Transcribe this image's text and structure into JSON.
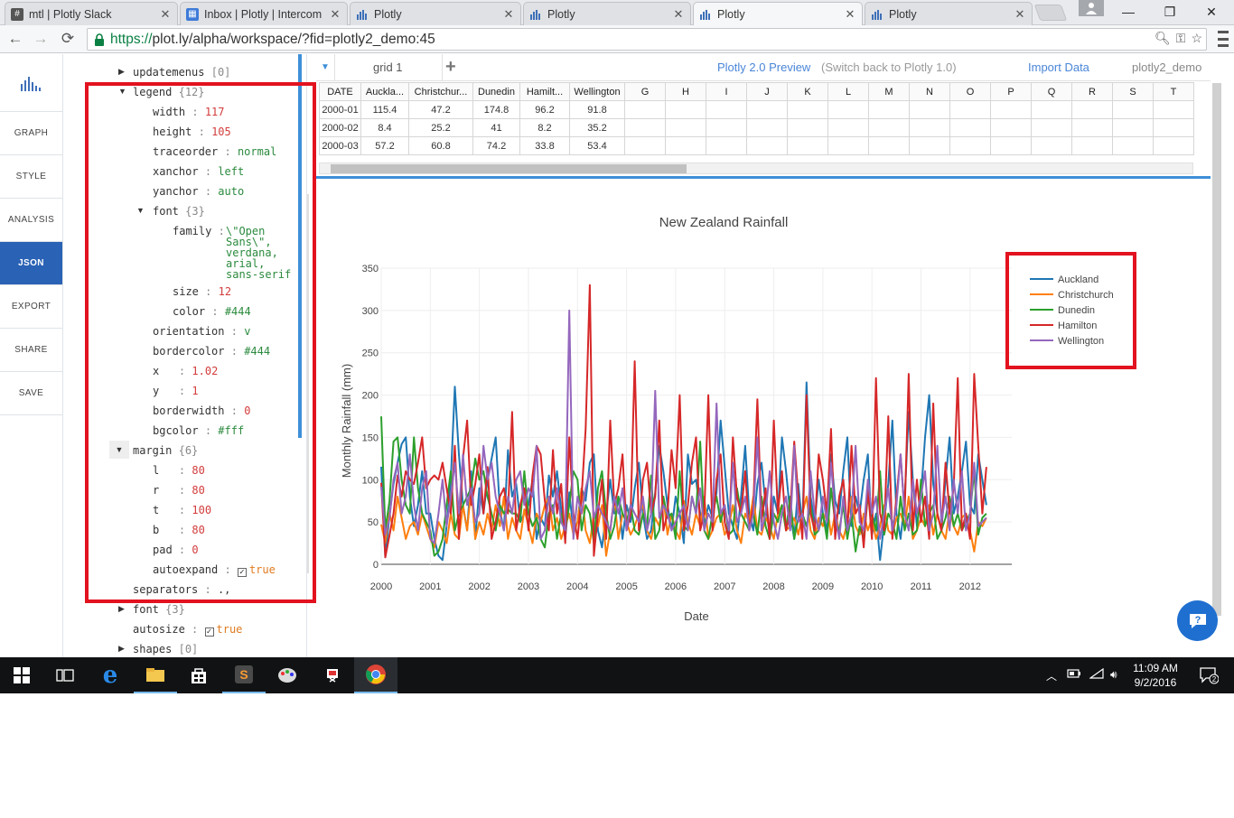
{
  "browser": {
    "tabs": [
      {
        "label": "mtl | Plotly Slack",
        "icon": "slack-hash-icon"
      },
      {
        "label": "Inbox | Plotly | Intercom",
        "icon": "intercom-icon"
      },
      {
        "label": "Plotly",
        "icon": "plotly-icon"
      },
      {
        "label": "Plotly",
        "icon": "plotly-icon"
      },
      {
        "label": "Plotly",
        "icon": "plotly-icon",
        "active": true
      },
      {
        "label": "Plotly",
        "icon": "plotly-icon"
      }
    ],
    "url_scheme": "https://",
    "url_rest": "plot.ly/alpha/workspace/?fid=plotly2_demo:45"
  },
  "sidebar": {
    "items": [
      {
        "label": "GRAPH"
      },
      {
        "label": "STYLE"
      },
      {
        "label": "ANALYSIS"
      },
      {
        "label": "JSON",
        "active": true
      },
      {
        "label": "EXPORT"
      },
      {
        "label": "SHARE"
      },
      {
        "label": "SAVE"
      }
    ]
  },
  "json_tree": {
    "updatemenus": {
      "key": "updatemenus",
      "count": "[0]"
    },
    "legend": {
      "key": "legend",
      "count": "{12}"
    },
    "width": {
      "key": "width",
      "value": "117"
    },
    "height": {
      "key": "height",
      "value": "105"
    },
    "traceorder": {
      "key": "traceorder",
      "value": "normal"
    },
    "xanchor": {
      "key": "xanchor",
      "value": "left"
    },
    "yanchor": {
      "key": "yanchor",
      "value": "auto"
    },
    "font": {
      "key": "font",
      "count": "{3}"
    },
    "family": {
      "key": "family",
      "value_lines": [
        "\\\"Open",
        "Sans\\\",",
        "verdana,",
        "arial,",
        "sans-serif"
      ]
    },
    "size": {
      "key": "size",
      "value": "12"
    },
    "color": {
      "key": "color",
      "value": "#444"
    },
    "orientation": {
      "key": "orientation",
      "value": "v"
    },
    "bordercolor": {
      "key": "bordercolor",
      "value": "#444"
    },
    "x": {
      "key": "x",
      "value": "1.02"
    },
    "y": {
      "key": "y",
      "value": "1"
    },
    "borderwidth": {
      "key": "borderwidth",
      "value": "0"
    },
    "bgcolor": {
      "key": "bgcolor",
      "value": "#fff"
    },
    "margin": {
      "key": "margin",
      "count": "{6}"
    },
    "l": {
      "key": "l",
      "value": "80"
    },
    "r": {
      "key": "r",
      "value": "80"
    },
    "t": {
      "key": "t",
      "value": "100"
    },
    "b": {
      "key": "b",
      "value": "80"
    },
    "pad": {
      "key": "pad",
      "value": "0"
    },
    "autoexpand": {
      "key": "autoexpand",
      "value": "true"
    },
    "separators": {
      "key": "separators",
      "value": ".,"
    },
    "font2": {
      "key": "font",
      "count": "{3}"
    },
    "autosize": {
      "key": "autosize",
      "value": "true"
    },
    "shapes": {
      "key": "shapes",
      "count": "[0]"
    }
  },
  "grid": {
    "tab_label": "grid 1",
    "preview_label": "Plotly 2.0 Preview",
    "switch_back": "(Switch back to Plotly 1.0)",
    "import_data": "Import Data",
    "file_name": "plotly2_demo",
    "columns": [
      "DATE",
      "Auckla...",
      "Christchur...",
      "Dunedin",
      "Hamilt...",
      "Wellington",
      "G",
      "H",
      "I",
      "J",
      "K",
      "L",
      "M",
      "N",
      "O",
      "P",
      "Q",
      "R",
      "S",
      "T"
    ],
    "rows": [
      [
        "2000-01",
        "115.4",
        "47.2",
        "174.8",
        "96.2",
        "91.8"
      ],
      [
        "2000-02",
        "8.4",
        "25.2",
        "41",
        "8.2",
        "35.2"
      ],
      [
        "2000-03",
        "57.2",
        "60.8",
        "74.2",
        "33.8",
        "53.4"
      ]
    ]
  },
  "colors": {
    "accent": "#2a62b5",
    "highlight": "#e3121f"
  },
  "chart_data": {
    "type": "line",
    "title": "New Zealand Rainfall",
    "xlabel": "Date",
    "ylabel": "Monthly Rainfall (mm)",
    "xlim": [
      2000,
      2012.85
    ],
    "ylim": [
      0,
      350
    ],
    "xticks": [
      "2000",
      "2001",
      "2002",
      "2003",
      "2004",
      "2005",
      "2006",
      "2007",
      "2008",
      "2009",
      "2010",
      "2011",
      "2012"
    ],
    "yticks": [
      "0",
      "50",
      "100",
      "150",
      "200",
      "250",
      "300",
      "350"
    ],
    "grid": true,
    "legend_position": "top-right",
    "x_start": "2000-01",
    "series": [
      {
        "name": "Auckland",
        "color": "#1f77b4",
        "values": [
          115.4,
          8.4,
          57.2,
          95,
          120,
          142,
          150,
          80,
          45,
          70,
          110,
          60,
          60,
          30,
          10,
          5,
          45,
          100,
          210,
          130,
          70,
          40,
          110,
          30,
          90,
          60,
          100,
          125,
          150,
          65,
          40,
          135,
          80,
          95,
          50,
          60,
          70,
          100,
          30,
          55,
          45,
          105,
          80,
          110,
          65,
          30,
          85,
          40,
          50,
          90,
          75,
          120,
          130,
          40,
          20,
          60,
          100,
          60,
          80,
          30,
          70,
          50,
          90,
          120,
          60,
          30,
          40,
          85,
          140,
          110,
          70,
          40,
          80,
          60,
          25,
          130,
          95,
          100,
          60,
          45,
          70,
          55,
          85,
          170,
          115,
          60,
          45,
          30,
          80,
          140,
          60,
          40,
          95,
          120,
          70,
          35,
          80,
          60,
          150,
          110,
          60,
          30,
          95,
          45,
          215,
          80,
          50,
          100,
          60,
          40,
          130,
          75,
          60,
          110,
          150,
          45,
          80,
          60,
          100,
          130,
          35,
          60,
          5,
          50,
          95,
          170,
          60,
          30,
          75,
          180,
          100,
          45,
          80,
          150,
          200,
          95,
          60,
          40,
          100,
          150,
          60,
          80,
          110,
          145,
          70,
          60,
          130,
          100,
          70
        ]
      },
      {
        "name": "Christchurch",
        "color": "#ff7f0e",
        "values": [
          47.2,
          25.2,
          60.8,
          40,
          80,
          55,
          30,
          45,
          50,
          35,
          60,
          45,
          30,
          20,
          50,
          40,
          25,
          60,
          35,
          30,
          70,
          40,
          90,
          30,
          50,
          35,
          60,
          40,
          70,
          45,
          80,
          30,
          55,
          40,
          30,
          65,
          45,
          25,
          60,
          50,
          70,
          80,
          40,
          55,
          30,
          45,
          60,
          35,
          50,
          90,
          40,
          25,
          60,
          45,
          70,
          10,
          40,
          80,
          30,
          60,
          50,
          35,
          45,
          60,
          70,
          40,
          30,
          55,
          45,
          80,
          35,
          60,
          40,
          30,
          75,
          50,
          35,
          60,
          45,
          80,
          30,
          40,
          55,
          60,
          35,
          45,
          70,
          40,
          25,
          60,
          50,
          80,
          40,
          35,
          55,
          45,
          30,
          60,
          70,
          40,
          45,
          55,
          35,
          60,
          80,
          40,
          30,
          55,
          45,
          70,
          35,
          60,
          40,
          30,
          50,
          80,
          45,
          35,
          60,
          40,
          55,
          30,
          45,
          70,
          40,
          35,
          55,
          60,
          45,
          80,
          30,
          40,
          55,
          45,
          70,
          35,
          60,
          40,
          30,
          65,
          45,
          35,
          55,
          60,
          40,
          15,
          50,
          45,
          55
        ]
      },
      {
        "name": "Dunedin",
        "color": "#2ca02c",
        "values": [
          174.8,
          41,
          74.2,
          145,
          150,
          100,
          70,
          60,
          150,
          90,
          60,
          50,
          40,
          10,
          15,
          30,
          70,
          110,
          40,
          60,
          70,
          80,
          90,
          125,
          100,
          110,
          80,
          60,
          40,
          70,
          60,
          65,
          60,
          60,
          50,
          110,
          60,
          45,
          55,
          30,
          20,
          60,
          70,
          30,
          60,
          40,
          70,
          110,
          100,
          40,
          70,
          60,
          25,
          90,
          110,
          60,
          30,
          45,
          80,
          60,
          50,
          70,
          40,
          35,
          60,
          45,
          105,
          30,
          40,
          80,
          55,
          60,
          30,
          110,
          45,
          40,
          80,
          60,
          145,
          40,
          30,
          60,
          80,
          50,
          70,
          35,
          40,
          90,
          60,
          50,
          40,
          60,
          35,
          80,
          45,
          30,
          60,
          50,
          70,
          40,
          80,
          30,
          55,
          60,
          45,
          70,
          35,
          40,
          60,
          30,
          90,
          50,
          40,
          70,
          30,
          60,
          15,
          45,
          30,
          80,
          60,
          40,
          110,
          35,
          60,
          50,
          30,
          80,
          40,
          60,
          35,
          40,
          100,
          45,
          60,
          70,
          30,
          40,
          55,
          80,
          45,
          60,
          40,
          50,
          60,
          110,
          35,
          55,
          60
        ]
      },
      {
        "name": "Hamilton",
        "color": "#d62728",
        "values": [
          96.2,
          8.2,
          33.8,
          60,
          105,
          80,
          110,
          100,
          95,
          120,
          150,
          90,
          100,
          105,
          100,
          120,
          90,
          60,
          140,
          30,
          125,
          170,
          70,
          95,
          130,
          60,
          115,
          30,
          50,
          80,
          90,
          60,
          180,
          40,
          70,
          90,
          40,
          105,
          140,
          130,
          75,
          40,
          135,
          60,
          95,
          25,
          150,
          60,
          30,
          80,
          160,
          330,
          10,
          60,
          100,
          30,
          170,
          70,
          90,
          130,
          40,
          60,
          240,
          40,
          100,
          120,
          60,
          80,
          170,
          40,
          60,
          135,
          90,
          200,
          40,
          70,
          120,
          150,
          40,
          60,
          200,
          40,
          100,
          130,
          50,
          30,
          150,
          80,
          60,
          110,
          40,
          70,
          195,
          50,
          90,
          30,
          170,
          60,
          110,
          40,
          60,
          145,
          80,
          30,
          200,
          60,
          40,
          130,
          100,
          60,
          160,
          30,
          80,
          100,
          40,
          140,
          60,
          70,
          20,
          90,
          30,
          220,
          60,
          40,
          175,
          30,
          80,
          130,
          60,
          225,
          40,
          100,
          50,
          80,
          30,
          190,
          60,
          40,
          120,
          60,
          90,
          220,
          40,
          60,
          30,
          225,
          140,
          60,
          115
        ]
      },
      {
        "name": "Wellington",
        "color": "#9467bd",
        "values": [
          91.8,
          35.2,
          53.4,
          100,
          120,
          60,
          80,
          130,
          70,
          40,
          90,
          110,
          30,
          25,
          60,
          100,
          45,
          80,
          120,
          60,
          130,
          70,
          90,
          50,
          60,
          140,
          100,
          120,
          80,
          60,
          40,
          80,
          60,
          100,
          110,
          70,
          90,
          80,
          140,
          30,
          40,
          80,
          60,
          90,
          50,
          40,
          300,
          30,
          80,
          60,
          90,
          110,
          55,
          70,
          60,
          50,
          40,
          80,
          60,
          90,
          40,
          70,
          60,
          50,
          80,
          40,
          60,
          205,
          55,
          70,
          60,
          40,
          50,
          60,
          70,
          40,
          80,
          60,
          90,
          40,
          60,
          50,
          190,
          60,
          70,
          40,
          120,
          50,
          60,
          80,
          40,
          60,
          150,
          40,
          60,
          110,
          50,
          30,
          60,
          80,
          40,
          140,
          50,
          60,
          30,
          110,
          60,
          40,
          80,
          50,
          120,
          60,
          30,
          80,
          40,
          60,
          140,
          50,
          40,
          100,
          60,
          80,
          30,
          60,
          90,
          40,
          70,
          130,
          60,
          40,
          100,
          60,
          80,
          110,
          40,
          60,
          140,
          50,
          80,
          40,
          100,
          60,
          110,
          40,
          60,
          120,
          45,
          50,
          55
        ]
      }
    ]
  },
  "taskbar": {
    "time": "11:09 AM",
    "date": "9/2/2016",
    "notifications": "2"
  }
}
